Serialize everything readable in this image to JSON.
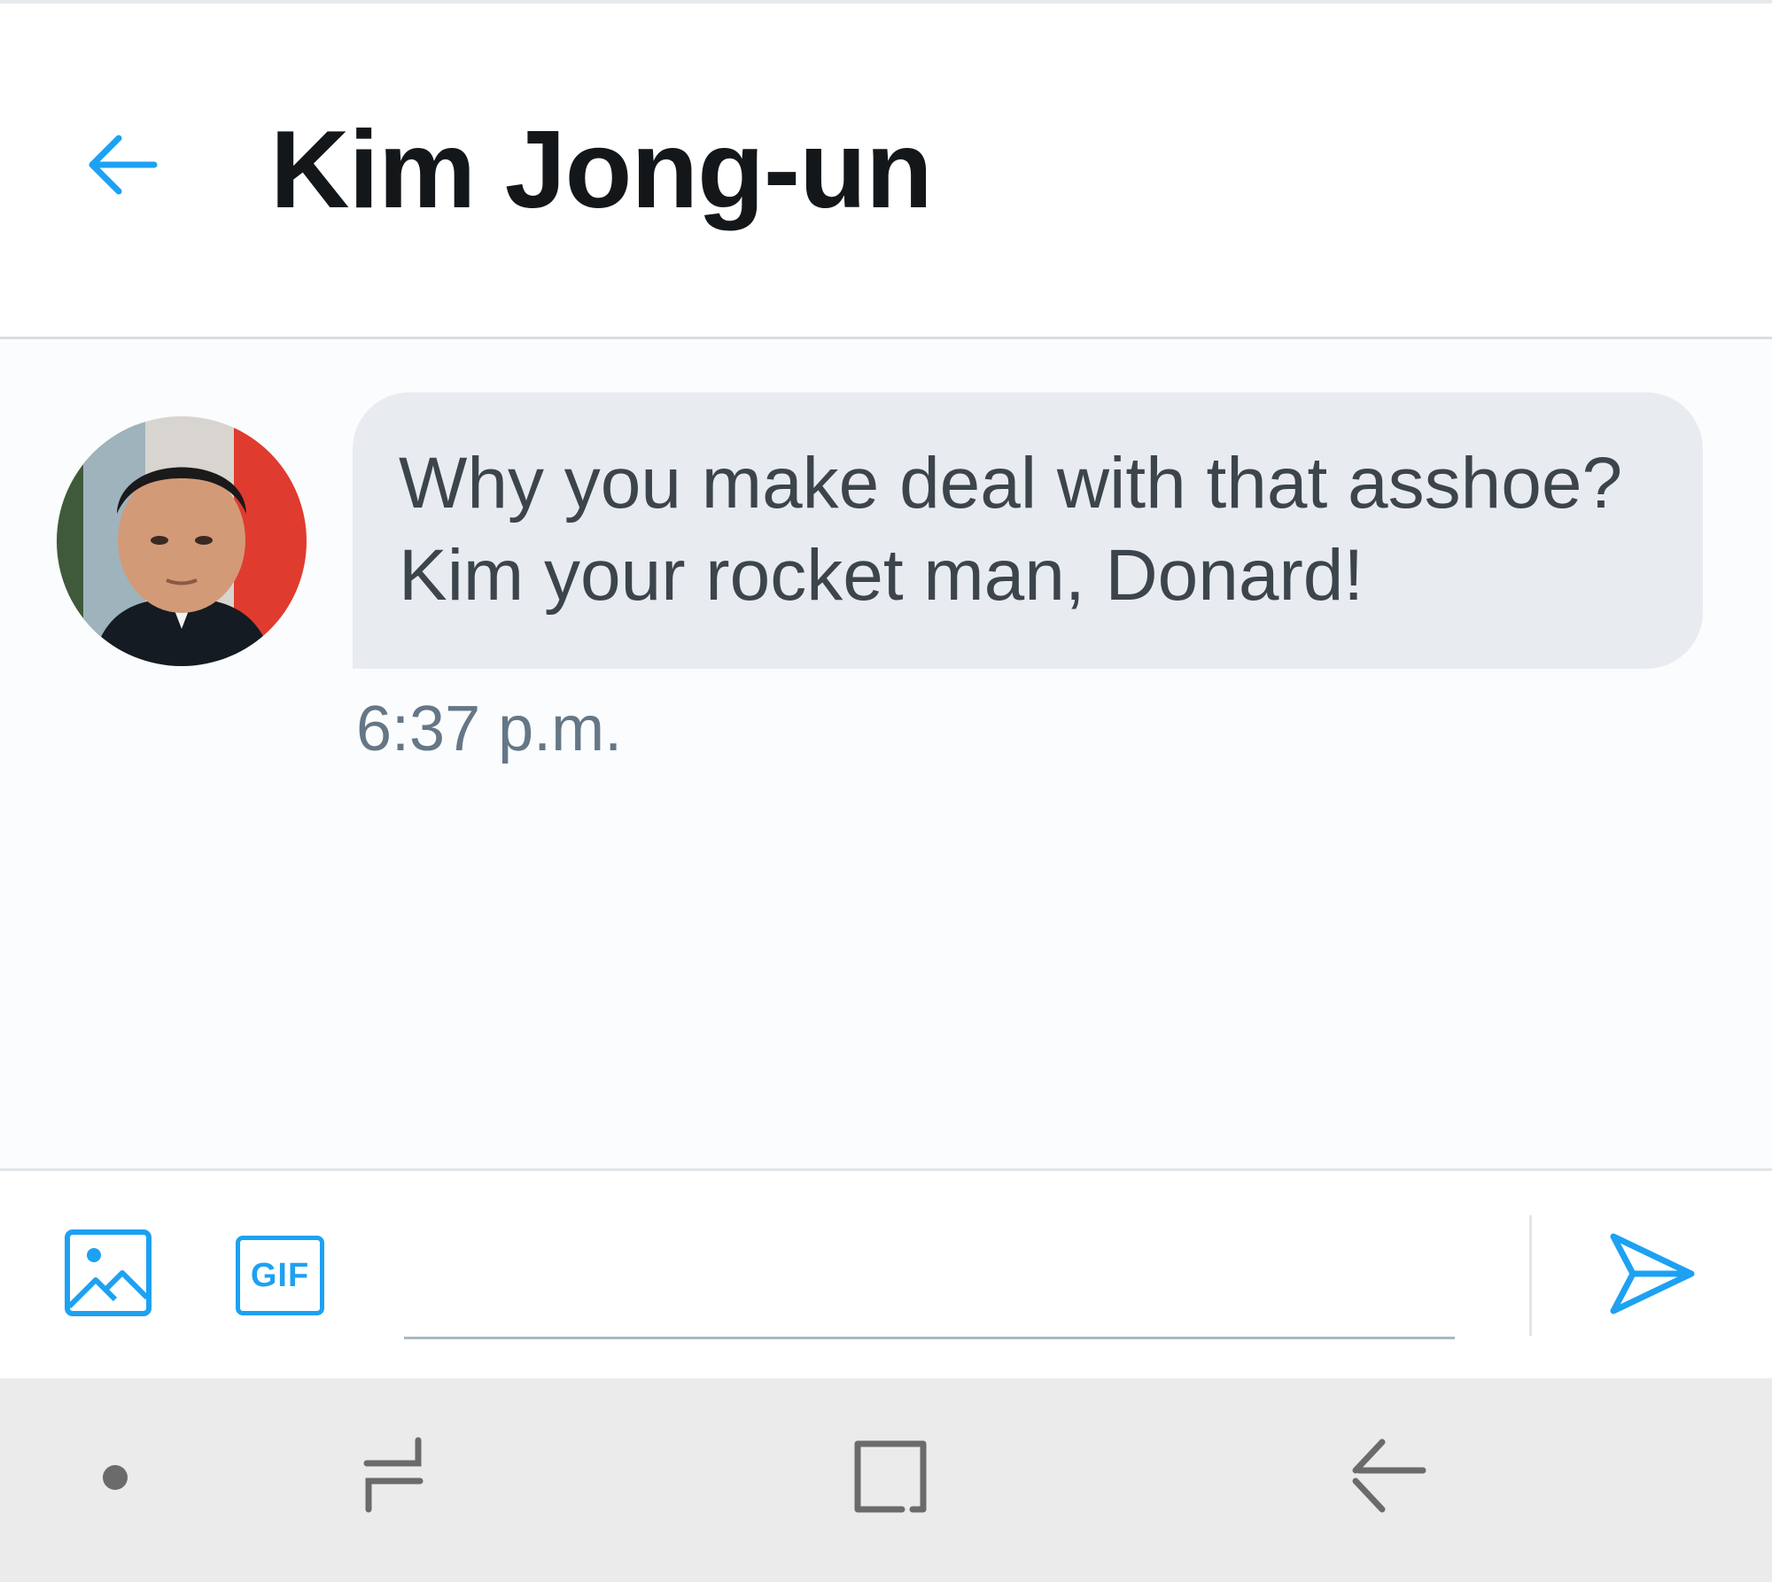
{
  "header": {
    "title": "Kim Jong-un",
    "back_icon": "arrow-left-icon"
  },
  "conversation": {
    "messages": [
      {
        "sender_avatar": "avatar-photo",
        "lines": [
          "Why you make deal with that asshoe?",
          "Kim your rocket man, Donard!"
        ],
        "time": "6:37 p.m."
      }
    ]
  },
  "composer": {
    "media_icon": "image-icon",
    "gif_label": "GIF",
    "input_value": "",
    "input_placeholder": "",
    "send_icon": "send-icon"
  },
  "navbar": {
    "items": [
      "dot-icon",
      "recents-icon",
      "home-icon",
      "back-icon"
    ]
  },
  "colors": {
    "accent": "#1da1f2",
    "title_text": "#14171a",
    "bubble_bg": "#e8ecf0",
    "message_text": "#3c444c",
    "timestamp_text": "#657786",
    "navbar_bg": "#ebebeb",
    "navbar_icon": "#6b6b6b"
  }
}
